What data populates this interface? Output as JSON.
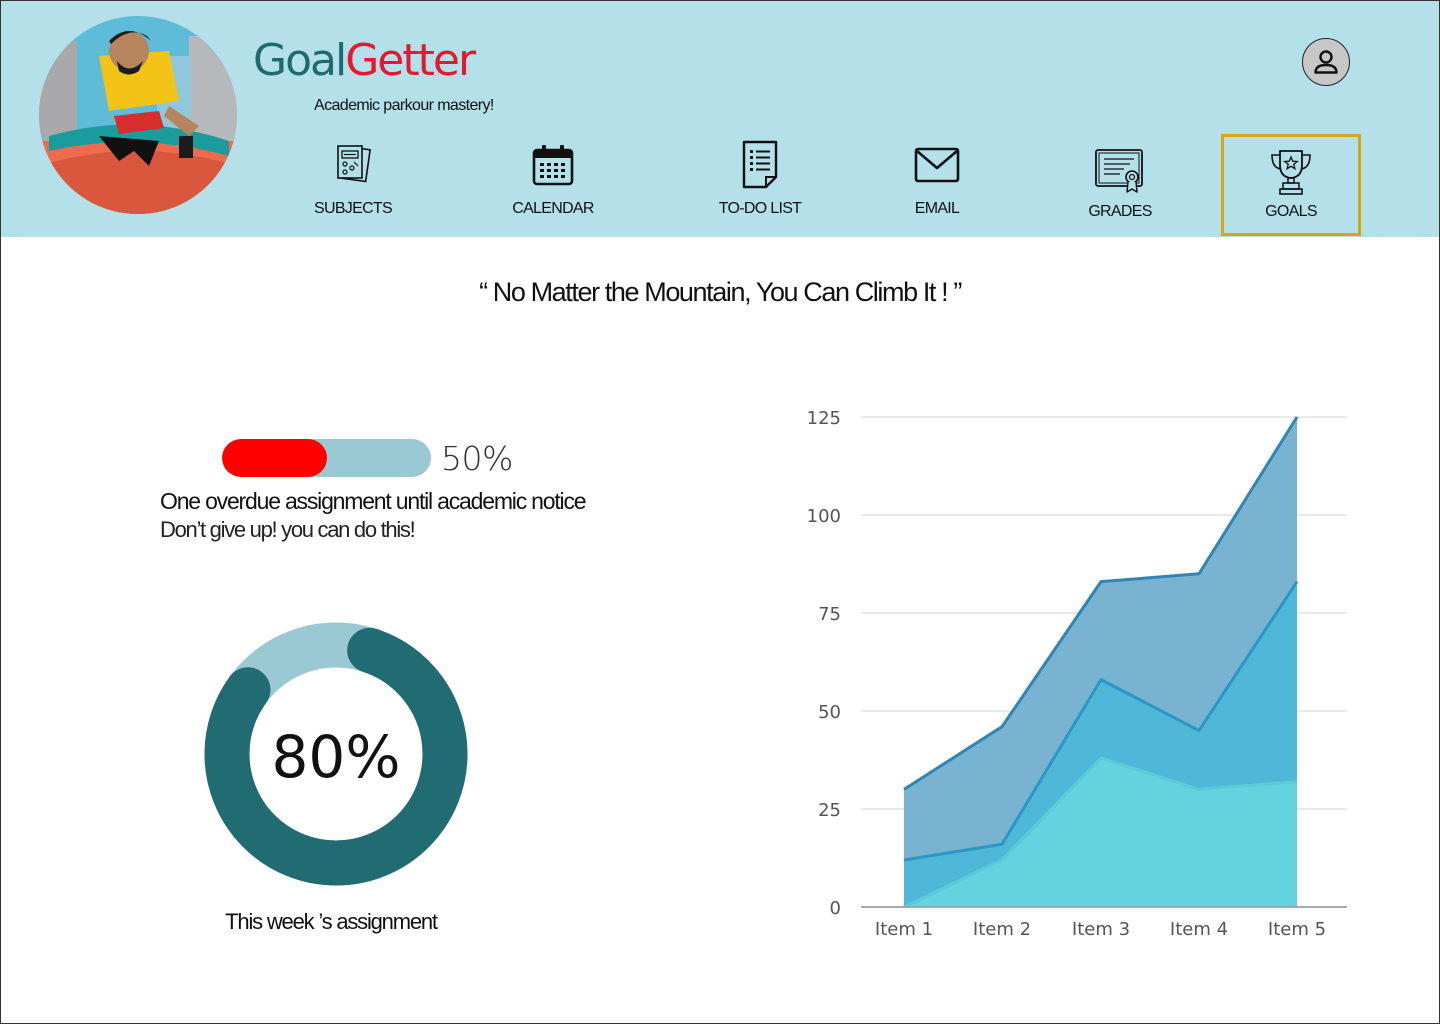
{
  "app": {
    "brand_part1": "Goal",
    "brand_part2": "Getter",
    "tagline": "Academic parkour mastery!"
  },
  "nav": {
    "items": [
      {
        "label": "SUBJECTS",
        "icon": "subjects-icon"
      },
      {
        "label": "CALENDAR",
        "icon": "calendar-icon"
      },
      {
        "label": "TO-DO LIST",
        "icon": "todo-list-icon"
      },
      {
        "label": "EMAIL",
        "icon": "email-icon"
      },
      {
        "label": "GRADES",
        "icon": "grades-icon"
      },
      {
        "label": "GOALS",
        "icon": "trophy-icon",
        "active": true
      }
    ]
  },
  "quote": "“ No Matter the Mountain, You Can Climb It ! ”",
  "overdue": {
    "progress": 0.5,
    "percent_label": "50%",
    "title": "One overdue assignment until academic notice",
    "subtitle": "Don’t give up! you can do this!"
  },
  "weekly": {
    "progress": 0.8,
    "percent_label": "80%",
    "caption": "This week ’s assignment"
  },
  "colors": {
    "header_bg": "#b4e0ea",
    "brand_dark": "#1f6b6b",
    "brand_red": "#e8172c",
    "active_border": "#d9a514",
    "progress_fill": "#ff0000",
    "progress_track": "#9ac9d3",
    "donut_fill": "#216b72",
    "donut_track": "#9ac9d3"
  },
  "chart_data": {
    "type": "area",
    "categories": [
      "Item 1",
      "Item 2",
      "Item 3",
      "Item 4",
      "Item 5"
    ],
    "ylim": [
      0,
      125
    ],
    "yticks": [
      "0",
      "25",
      "50",
      "75",
      "100",
      "125"
    ],
    "grid": true,
    "series": [
      {
        "values": [
          30,
          46,
          83,
          85,
          125
        ],
        "color": "#78b3d1",
        "line": "#2f86b6"
      },
      {
        "values": [
          12,
          16,
          58,
          45,
          83
        ],
        "color": "#4fb7d7",
        "line": "#2b97c5"
      },
      {
        "values": [
          0,
          12,
          38,
          30,
          32
        ],
        "color": "#63d3df",
        "line": "#5ccbd9"
      }
    ]
  }
}
